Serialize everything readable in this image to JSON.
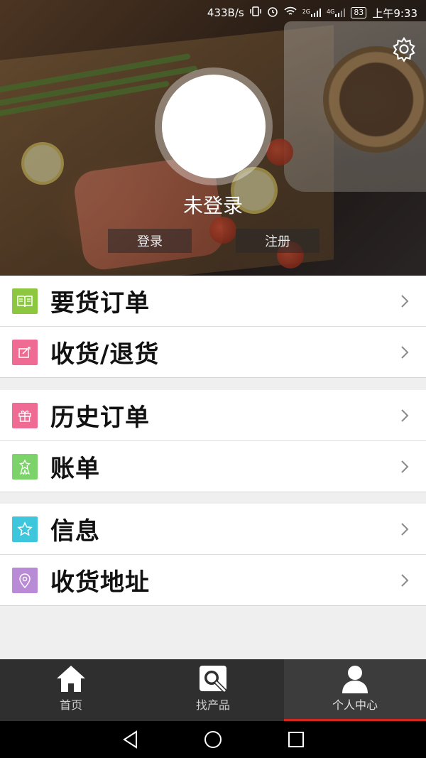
{
  "status_bar": {
    "network_speed": "433B/s",
    "signal_2g": "2G",
    "signal_4g": "4G",
    "battery": "83",
    "time": "上午9:33"
  },
  "profile": {
    "username": "未登录",
    "login_label": "登录",
    "register_label": "注册"
  },
  "menu": {
    "group1": [
      {
        "label": "要货订单",
        "icon": "book-icon",
        "color": "#8dc63f"
      },
      {
        "label": "收货/退货",
        "icon": "edit-box-icon",
        "color": "#f06b94"
      }
    ],
    "group2": [
      {
        "label": "历史订单",
        "icon": "gift-icon",
        "color": "#f06b94"
      },
      {
        "label": "账单",
        "icon": "award-icon",
        "color": "#7bd36a"
      }
    ],
    "group3": [
      {
        "label": "信息",
        "icon": "star-icon",
        "color": "#3ec6dc"
      },
      {
        "label": "收货地址",
        "icon": "location-pin-icon",
        "color": "#b98ad6"
      }
    ]
  },
  "bottom_nav": {
    "home_label": "首页",
    "find_label": "找产品",
    "profile_label": "个人中心",
    "active": "profile",
    "accent": "#d6271f"
  }
}
